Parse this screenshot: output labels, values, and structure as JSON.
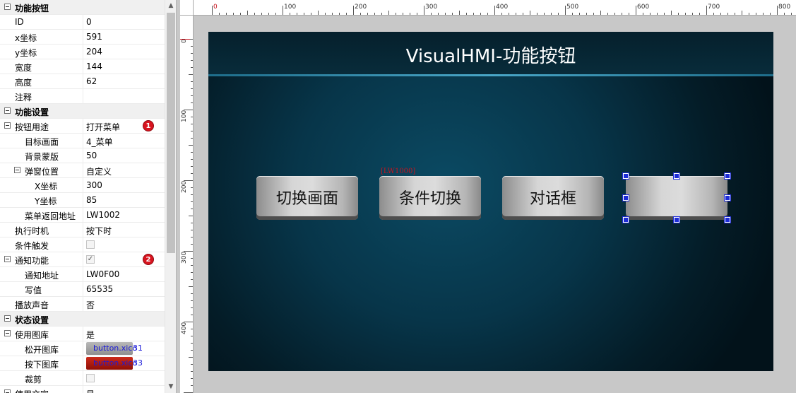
{
  "panel": {
    "categories": {
      "function_button": "功能按钮",
      "function_settings": "功能设置",
      "state_settings": "状态设置"
    },
    "rows": {
      "id": {
        "key": "ID",
        "value": "0"
      },
      "x": {
        "key": "x坐标",
        "value": "591"
      },
      "y": {
        "key": "y坐标",
        "value": "204"
      },
      "width": {
        "key": "宽度",
        "value": "144"
      },
      "height": {
        "key": "高度",
        "value": "62"
      },
      "note": {
        "key": "注释",
        "value": ""
      },
      "purpose": {
        "key": "按钮用途",
        "value": "打开菜单"
      },
      "target_screen": {
        "key": "目标画面",
        "value": "4_菜单"
      },
      "bg_mask": {
        "key": "背景蒙版",
        "value": "50"
      },
      "popup_pos": {
        "key": "弹窗位置",
        "value": "自定义"
      },
      "popup_x": {
        "key": "X坐标",
        "value": "300"
      },
      "popup_y": {
        "key": "Y坐标",
        "value": "85"
      },
      "menu_return": {
        "key": "菜单返回地址",
        "value": "LW1002"
      },
      "exec_time": {
        "key": "执行时机",
        "value": "按下时"
      },
      "cond_trigger": {
        "key": "条件触发",
        "checked": false
      },
      "notify": {
        "key": "通知功能",
        "checked": true
      },
      "notify_addr": {
        "key": "通知地址",
        "value": "LW0F00"
      },
      "write_value": {
        "key": "写值",
        "value": "65535"
      },
      "play_sound": {
        "key": "播放声音",
        "value": "否"
      },
      "use_gallery": {
        "key": "使用图库",
        "value": "是"
      },
      "release_img": {
        "key": "松开图库",
        "value": "button.xico",
        "index": "31"
      },
      "press_img": {
        "key": "按下图库",
        "value": "button.xico",
        "index": "33"
      },
      "crop": {
        "key": "裁剪",
        "checked": false
      },
      "use_text": {
        "key": "使用文字",
        "value": "是"
      }
    },
    "badges": {
      "one": "1",
      "two": "2"
    }
  },
  "ruler": {
    "h_labels": [
      "0",
      "100",
      "200",
      "300",
      "400",
      "500",
      "600",
      "700",
      "800"
    ],
    "v_labels": [
      "0",
      "100",
      "200",
      "300",
      "400"
    ]
  },
  "screen": {
    "title": "VisualHMI-功能按钮",
    "buttons": [
      "切换画面",
      "条件切换",
      "对话框",
      ""
    ],
    "lw_tag": "[LW1000]"
  },
  "colors": {
    "badge": "#d8141f",
    "handle": "#1d2bd6",
    "screen_bg": "#073549",
    "title_line": "#4aa7c8"
  }
}
